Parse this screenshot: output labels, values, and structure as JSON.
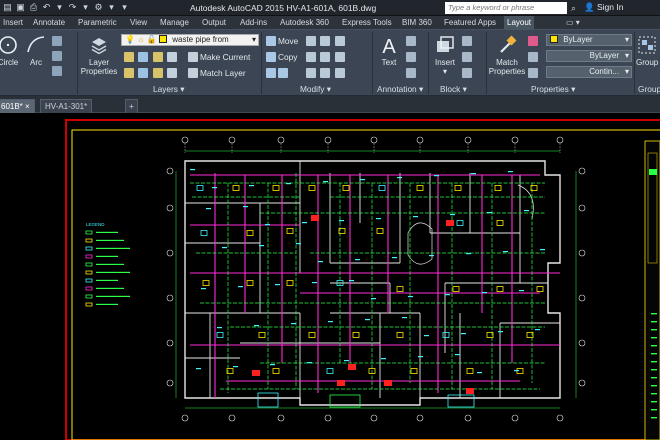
{
  "title_bar": {
    "title": "Autodesk AutoCAD 2015   HV-A1-601A, 601B.dwg",
    "search_placeholder": "Type a keyword or phrase",
    "user": "Sign In"
  },
  "ribbon_tabs": [
    "Insert",
    "Annotate",
    "Parametric",
    "View",
    "Manage",
    "Output",
    "Add-ins",
    "Autodesk 360",
    "Express Tools",
    "BIM 360",
    "Featured Apps",
    "Layout"
  ],
  "active_tab": "Layout",
  "ribbon": {
    "draw": {
      "circle": "Circle",
      "arc": "Arc"
    },
    "layers": {
      "layer_properties": "Layer Properties",
      "current_layer": "waste pipe from",
      "make_current": "Make Current",
      "match_layer": "Match Layer",
      "panel": "Layers ▾"
    },
    "modify": {
      "move": "Move",
      "copy": "Copy",
      "panel": "Modify ▾"
    },
    "annotation": {
      "text": "Text",
      "panel": "Annotation ▾"
    },
    "block": {
      "insert": "Insert",
      "panel": "Block ▾"
    },
    "properties": {
      "match_properties": "Match Properties",
      "color": "ByLayer",
      "linetype": "ByLayer",
      "lineweight": "Contin...",
      "panel": "Properties ▾"
    },
    "groups": {
      "group": "Group",
      "panel": "Group"
    }
  },
  "doc_tabs": [
    "601B*",
    "HV-A1-301*",
    "+"
  ],
  "drawing": {
    "legend_title": "LEGEND",
    "accent_colors": {
      "wall": "#e6e6e6",
      "duct": "#ff2bd6",
      "pipe": "#2aff4a",
      "equipment": "#ffe600",
      "dim": "#3df6ff",
      "alert": "#ff2020"
    }
  }
}
